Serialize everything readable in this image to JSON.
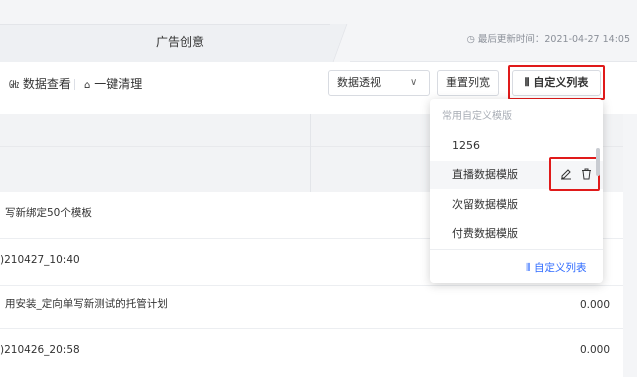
{
  "tabbar": {
    "active_tab": "广告创意",
    "updated_text": "最后更新时间：2021-04-27 14:05"
  },
  "toolbar": {
    "data_view": "数据查看",
    "one_click_clear": "一键清理",
    "pivot_select": "数据透视",
    "reset_width": "重置列宽",
    "custom_columns": "自定义列表"
  },
  "table": {
    "rows": [
      {
        "name": "写新绑定50个模板",
        "value": ""
      },
      {
        "name": ")210427_10:40",
        "value": ""
      },
      {
        "name": "用安装_定向单写新测试的托管计划",
        "value": "0.000"
      },
      {
        "name": ")210426_20:58",
        "value": "0.000"
      }
    ]
  },
  "dropdown": {
    "title": "常用自定义模版",
    "items": [
      "1256",
      "直播数据模版",
      "次留数据模版",
      "付费数据模版"
    ],
    "footer": "自定义列表"
  },
  "colors": {
    "accent_blue": "#2f6bff",
    "highlight_red": "#e01a1a"
  }
}
